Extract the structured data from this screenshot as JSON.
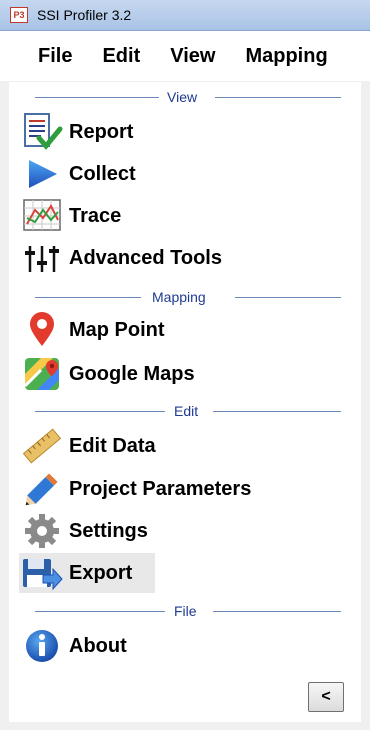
{
  "window": {
    "title": "SSI Profiler 3.2",
    "app_icon_text": "P3"
  },
  "menubar": {
    "items": [
      "File",
      "Edit",
      "View",
      "Mapping"
    ]
  },
  "sections": {
    "view": "View",
    "mapping": "Mapping",
    "edit": "Edit",
    "file": "File"
  },
  "items": {
    "report": {
      "label": "Report",
      "icon": "report-icon"
    },
    "collect": {
      "label": "Collect",
      "icon": "play-icon"
    },
    "trace": {
      "label": "Trace",
      "icon": "trace-chart-icon"
    },
    "advanced": {
      "label": "Advanced Tools",
      "icon": "sliders-icon"
    },
    "map_point": {
      "label": "Map Point",
      "icon": "map-pin-icon"
    },
    "google_maps": {
      "label": "Google Maps",
      "icon": "google-maps-icon"
    },
    "edit_data": {
      "label": "Edit Data",
      "icon": "ruler-icon"
    },
    "project_params": {
      "label": "Project Parameters",
      "icon": "pencil-icon"
    },
    "settings": {
      "label": "Settings",
      "icon": "gear-icon"
    },
    "export": {
      "label": "Export",
      "icon": "floppy-export-icon"
    },
    "about": {
      "label": "About",
      "icon": "info-icon"
    }
  },
  "collapse_button": {
    "label": "<"
  },
  "colors": {
    "section_text": "#1f3a93",
    "section_line": "#6b89b8",
    "titlebar": "#b7cdea"
  }
}
